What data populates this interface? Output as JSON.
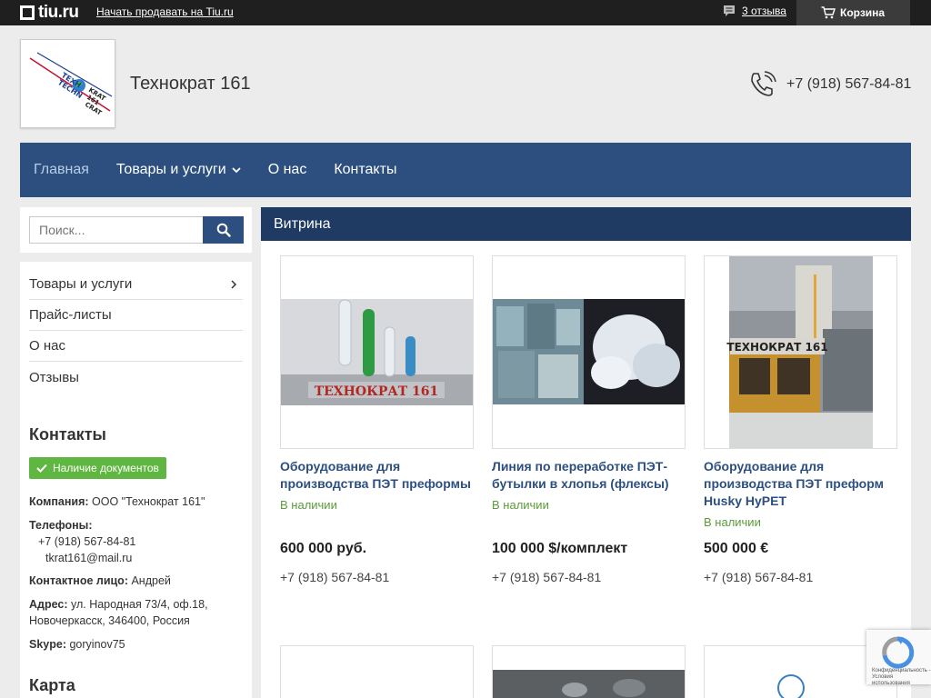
{
  "topbar": {
    "logo_text": "tiu.ru",
    "sell_link": "Начать продавать на Tiu.ru",
    "reviews_link": "3 отзыва",
    "cart_label": "Корзина"
  },
  "header": {
    "company_name": "Технократ 161",
    "phone": "+7 (918) 567-84-81"
  },
  "nav": {
    "items": [
      {
        "label": "Главная"
      },
      {
        "label": "Товары и услуги"
      },
      {
        "label": "О нас"
      },
      {
        "label": "Контакты"
      }
    ]
  },
  "search": {
    "placeholder": "Поиск..."
  },
  "sidebar": {
    "menu": [
      {
        "label": "Товары и услуги"
      },
      {
        "label": "Прайс-листы"
      },
      {
        "label": "О нас"
      },
      {
        "label": "Отзывы"
      }
    ],
    "contacts_title": "Контакты",
    "docs_badge": "Наличие документов",
    "company_label": "Компания:",
    "company_value": "ООО \"Технократ 161\"",
    "phones_label": "Телефоны:",
    "phone_value": "+7 (918) 567-84-81",
    "email_value": "tkrat161@mail.ru",
    "contact_person_label": "Контактное лицо:",
    "contact_person_value": "Андрей",
    "address_label": "Адрес:",
    "address_value_1": "ул. Народная 73/4, оф.18,",
    "address_value_2": "Новочеркасск, 346400, Россия",
    "skype_label": "Skype:",
    "skype_value": "goryinov75",
    "map_title": "Карта"
  },
  "main": {
    "title": "Витрина",
    "products": [
      {
        "title_1": "Оборудование для",
        "title_2": "производства ПЭТ преформы",
        "title_3": "",
        "stock": "В наличии",
        "price": "600 000 руб.",
        "phone": "+7 (918) 567-84-81",
        "image_caption": "ТЕХНОКРАТ 161"
      },
      {
        "title_1": "Линия по переработке ПЭТ-",
        "title_2": "бутылки в хлопья (флексы)",
        "title_3": "",
        "stock": "В наличии",
        "price": "100 000 $/комплект",
        "phone": "+7 (918) 567-84-81"
      },
      {
        "title_1": "Оборудование для",
        "title_2": "производства ПЭТ преформ",
        "title_3": "Husky HyPET",
        "stock": "В наличии",
        "price": "500 000 €",
        "phone": "+7 (918) 567-84-81",
        "image_caption": "ТЕХНОКРАТ 161"
      }
    ]
  },
  "recaptcha": {
    "text_1": "Конфиденциальность -",
    "text_2": "Условия использования"
  },
  "colors": {
    "nav": "#2d4f80",
    "main_header": "#1f3a63",
    "badge": "#5fb641",
    "stock": "#5a9b3a",
    "link": "#2d4f80"
  },
  "icons": [
    "comment-icon",
    "cart-icon",
    "phone-icon",
    "chevron-down-icon",
    "search-icon",
    "chevron-right-icon",
    "check-icon",
    "recaptcha-icon"
  ]
}
